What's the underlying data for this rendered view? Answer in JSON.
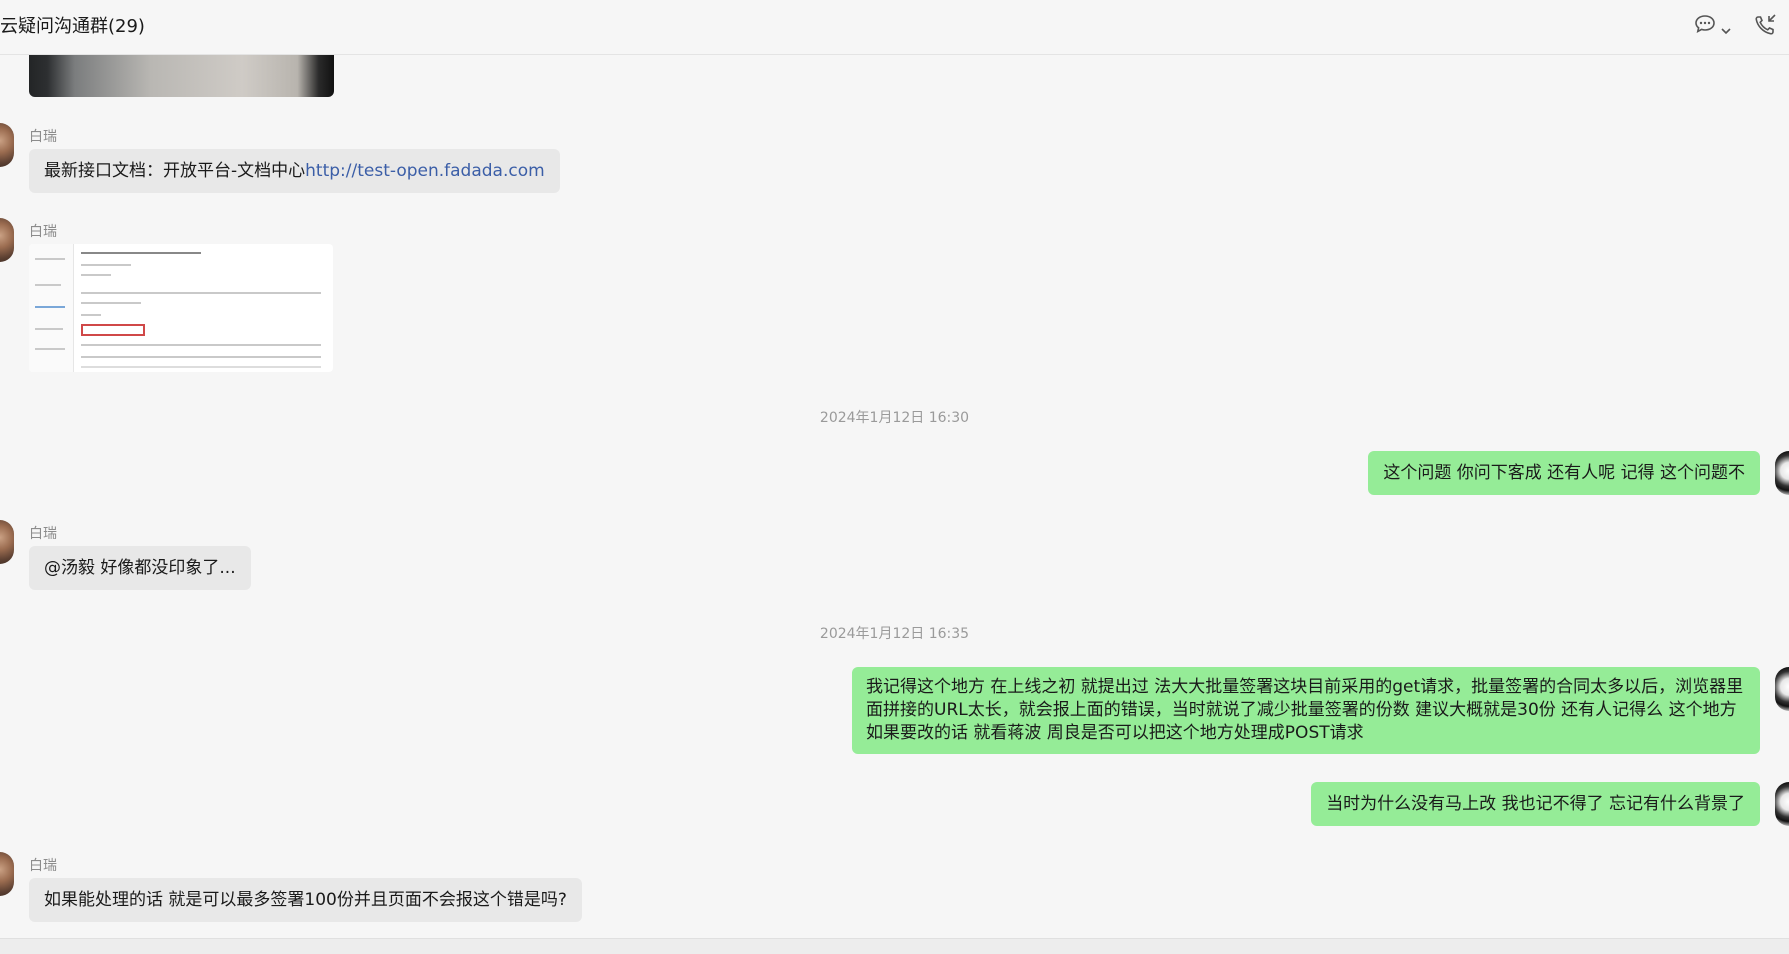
{
  "header": {
    "title": "云疑问沟通群",
    "member_count": "(29)"
  },
  "messages": {
    "m1": {
      "sender": "白瑞",
      "text": "最新接口文档：开放平台-文档中心",
      "link": "http://test-open.fadada.com"
    },
    "m2": {
      "sender": "白瑞"
    },
    "time1": "2024年1月12日 16:30",
    "m3": {
      "text": "这个问题  你问下客成 还有人呢 记得 这个问题不"
    },
    "m4": {
      "sender": "白瑞",
      "text": "@汤毅 好像都没印象了..."
    },
    "time2": "2024年1月12日 16:35",
    "m5": {
      "text": "我记得这个地方 在上线之初 就提出过  法大大批量签署这块目前采用的get请求，批量签署的合同太多以后，浏览器里面拼接的URL太长，就会报上面的错误，当时就说了减少批量签署的份数  建议大概就是30份  还有人记得么     这个地方如果要改的话  就看蒋波 周良是否可以把这个地方处理成POST请求"
    },
    "m6": {
      "text": "当时为什么没有马上改  我也记不得了    忘记有什么背景了"
    },
    "m7": {
      "sender": "白瑞",
      "text": "如果能处理的话 就是可以最多签署100份并且页面不会报这个错是吗?"
    }
  },
  "icons": {
    "chat": "chat-bubble-icon",
    "chevron": "chevron-down-icon",
    "phone": "phone-call-icon"
  },
  "colors": {
    "incoming_bubble": "#e8e8e8",
    "outgoing_bubble": "#95ec97",
    "link": "#3b5ea7"
  }
}
